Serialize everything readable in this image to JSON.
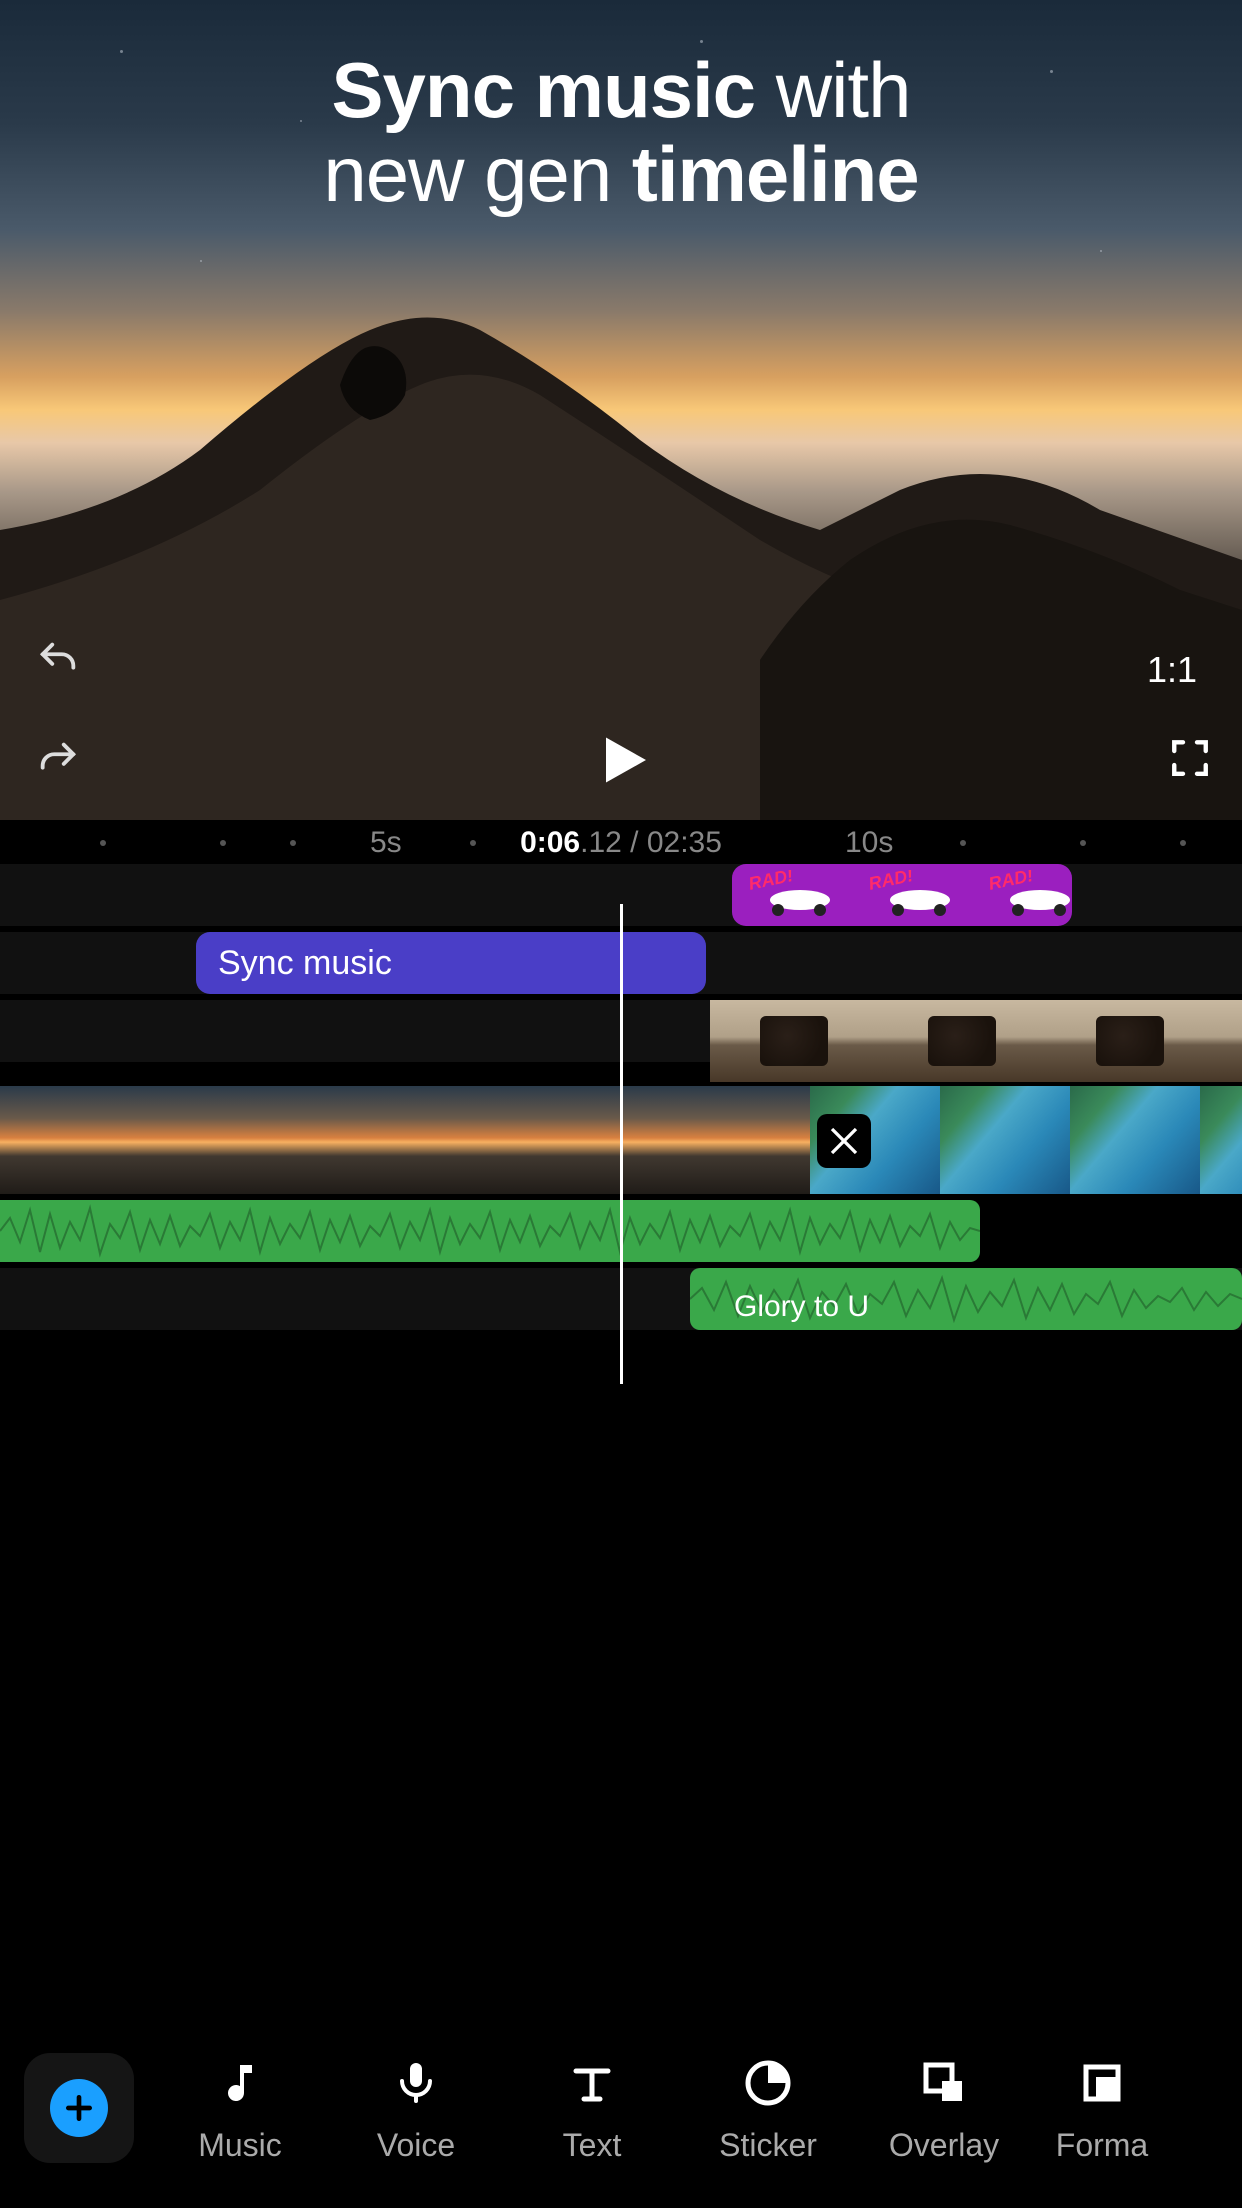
{
  "headline": {
    "part1_bold": "Sync music",
    "part2": " with",
    "part3": "new gen ",
    "part4_bold": "timeline"
  },
  "preview": {
    "aspect_ratio": "1:1"
  },
  "ruler": {
    "tick_left": "5s",
    "tick_right": "10s",
    "current_whole": "0:06",
    "current_frac": ".12",
    "sep": " / ",
    "total": "02:35"
  },
  "clips": {
    "sticker_badge": "RAD!",
    "text_clip_label": "Sync music",
    "audio2_label": "Glory to U"
  },
  "toolbar": {
    "items": [
      {
        "id": "music",
        "label": "Music"
      },
      {
        "id": "voice",
        "label": "Voice"
      },
      {
        "id": "text",
        "label": "Text"
      },
      {
        "id": "sticker",
        "label": "Sticker"
      },
      {
        "id": "overlay",
        "label": "Overlay"
      },
      {
        "id": "format",
        "label": "Forma"
      }
    ]
  }
}
